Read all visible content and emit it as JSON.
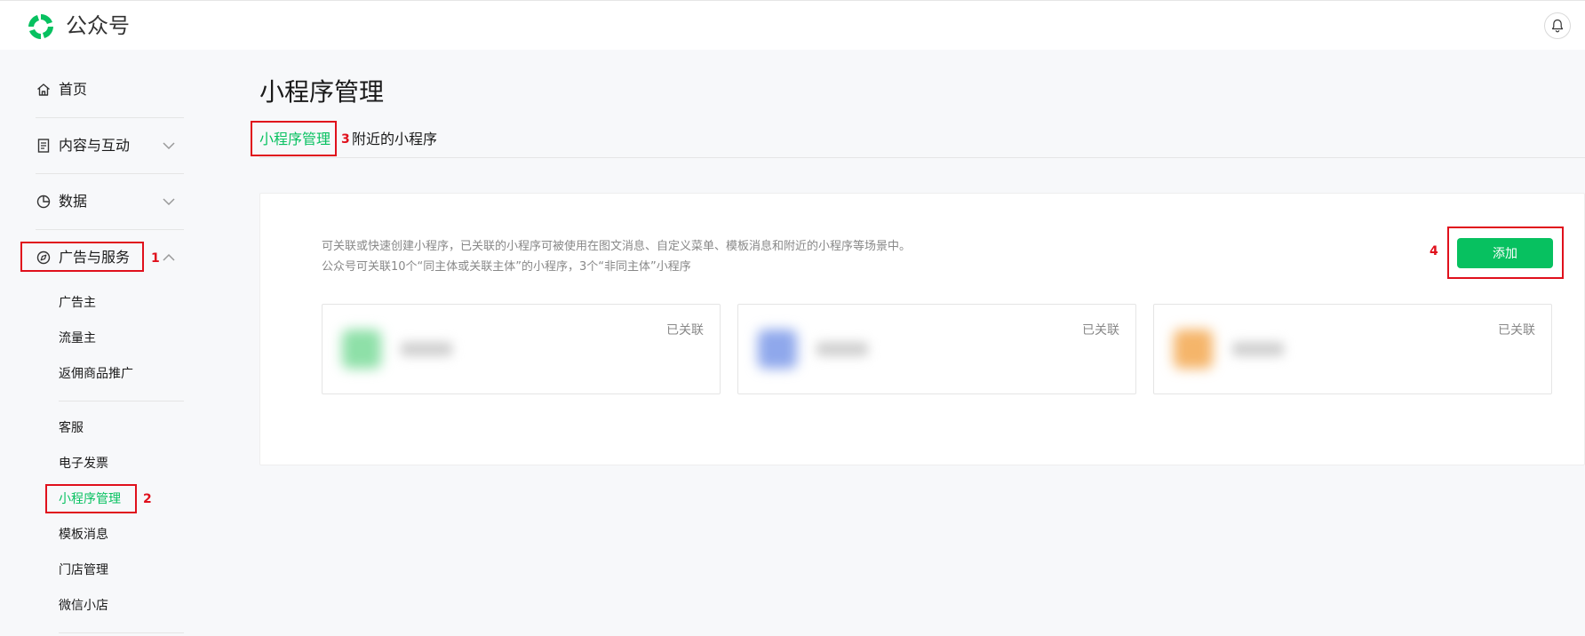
{
  "header": {
    "brand": "公众号",
    "logo_icon": "wechat-official-account-logo",
    "notification_icon": "bell-icon"
  },
  "sidebar": {
    "items": [
      {
        "label": "首页",
        "icon": "home-icon"
      },
      {
        "label": "内容与互动",
        "icon": "document-icon",
        "chevron": "down"
      },
      {
        "label": "数据",
        "icon": "pie-chart-icon",
        "chevron": "down"
      },
      {
        "label": "广告与服务",
        "icon": "compass-icon",
        "chevron": "up"
      }
    ],
    "ad_sub_items": [
      "广告主",
      "流量主",
      "返佣商品推广"
    ],
    "service_sub_items": [
      "客服",
      "电子发票",
      "小程序管理",
      "模板消息",
      "门店管理",
      "微信小店"
    ],
    "active_sub_item": "小程序管理"
  },
  "main": {
    "title": "小程序管理",
    "tabs": [
      {
        "label": "小程序管理",
        "active": true
      },
      {
        "label": "附近的小程序",
        "active": false
      }
    ],
    "description": [
      "可关联或快速创建小程序，已关联的小程序可被使用在图文消息、自定义菜单、模板消息和附近的小程序等场景中。",
      "公众号可关联10个“同主体或关联主体”的小程序，3个“非同主体”小程序"
    ],
    "add_button": "添加",
    "cards": [
      {
        "status": "已关联",
        "avatar_color": "#8ee0a8"
      },
      {
        "status": "已关联",
        "avatar_color": "#8fa8ec"
      },
      {
        "status": "已关联",
        "avatar_color": "#f5b56a"
      }
    ]
  },
  "annotations": [
    "1",
    "2",
    "3",
    "4"
  ],
  "colors": {
    "accent": "#07c160",
    "annotation": "#e0101c"
  }
}
